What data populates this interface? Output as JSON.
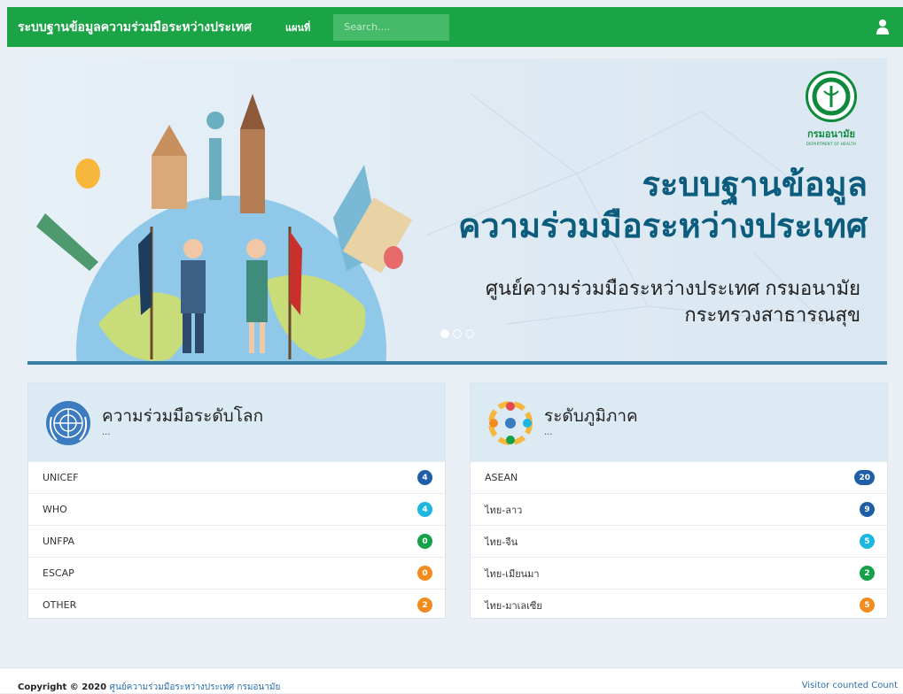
{
  "navbar": {
    "brand": "ระบบฐานข้อมูลความร่วมมือระหว่างประเทศ",
    "map_link": "แผนที่",
    "search_placeholder": "Search....",
    "user_icon": "user-icon",
    "color": "#1aa446"
  },
  "banner": {
    "title_line1": "ระบบฐานข้อมูล",
    "title_line2": "ความร่วมมือระหว่างประเทศ",
    "subtitle_line1": "ศูนย์ความร่วมมือระหว่างประเทศ กรมอนามัย",
    "subtitle_line2": "กระทรวงสาธารณสุข",
    "logo_name": "กรมอนามัย",
    "logo_sub": "DEPARTMENT OF HEALTH",
    "slides": 3,
    "active_slide": 1
  },
  "global_panel": {
    "title": "ความร่วมมือระดับโลก",
    "dots": "...",
    "icon": "un-globe-icon",
    "items": [
      {
        "label": "UNICEF",
        "count": "4",
        "color": "#1e5fa8"
      },
      {
        "label": "WHO",
        "count": "4",
        "color": "#1bb7e0"
      },
      {
        "label": "UNFPA",
        "count": "0",
        "color": "#14a14a"
      },
      {
        "label": "ESCAP",
        "count": "0",
        "color": "#f28c1e"
      },
      {
        "label": "OTHER",
        "count": "2",
        "color": "#f28c1e"
      }
    ]
  },
  "regional_panel": {
    "title": "ระดับภูมิภาค",
    "dots": "...",
    "icon": "regional-network-icon",
    "items": [
      {
        "label": "ASEAN",
        "count": "20",
        "color": "#1e5fa8"
      },
      {
        "label": "ไทย-ลาว",
        "count": "9",
        "color": "#1e5fa8"
      },
      {
        "label": "ไทย-จีน",
        "count": "5",
        "color": "#1bb7e0"
      },
      {
        "label": "ไทย-เมียนมา",
        "count": "2",
        "color": "#14a14a"
      },
      {
        "label": "ไทย-มาเลเซีย",
        "count": "5",
        "color": "#f28c1e"
      }
    ]
  },
  "footer": {
    "copyright": "Copyright © 2020",
    "org": "ศูนย์ความร่วมมือระหว่างประเทศ กรมอนามัย",
    "visitor": "Visitor counted Count"
  }
}
